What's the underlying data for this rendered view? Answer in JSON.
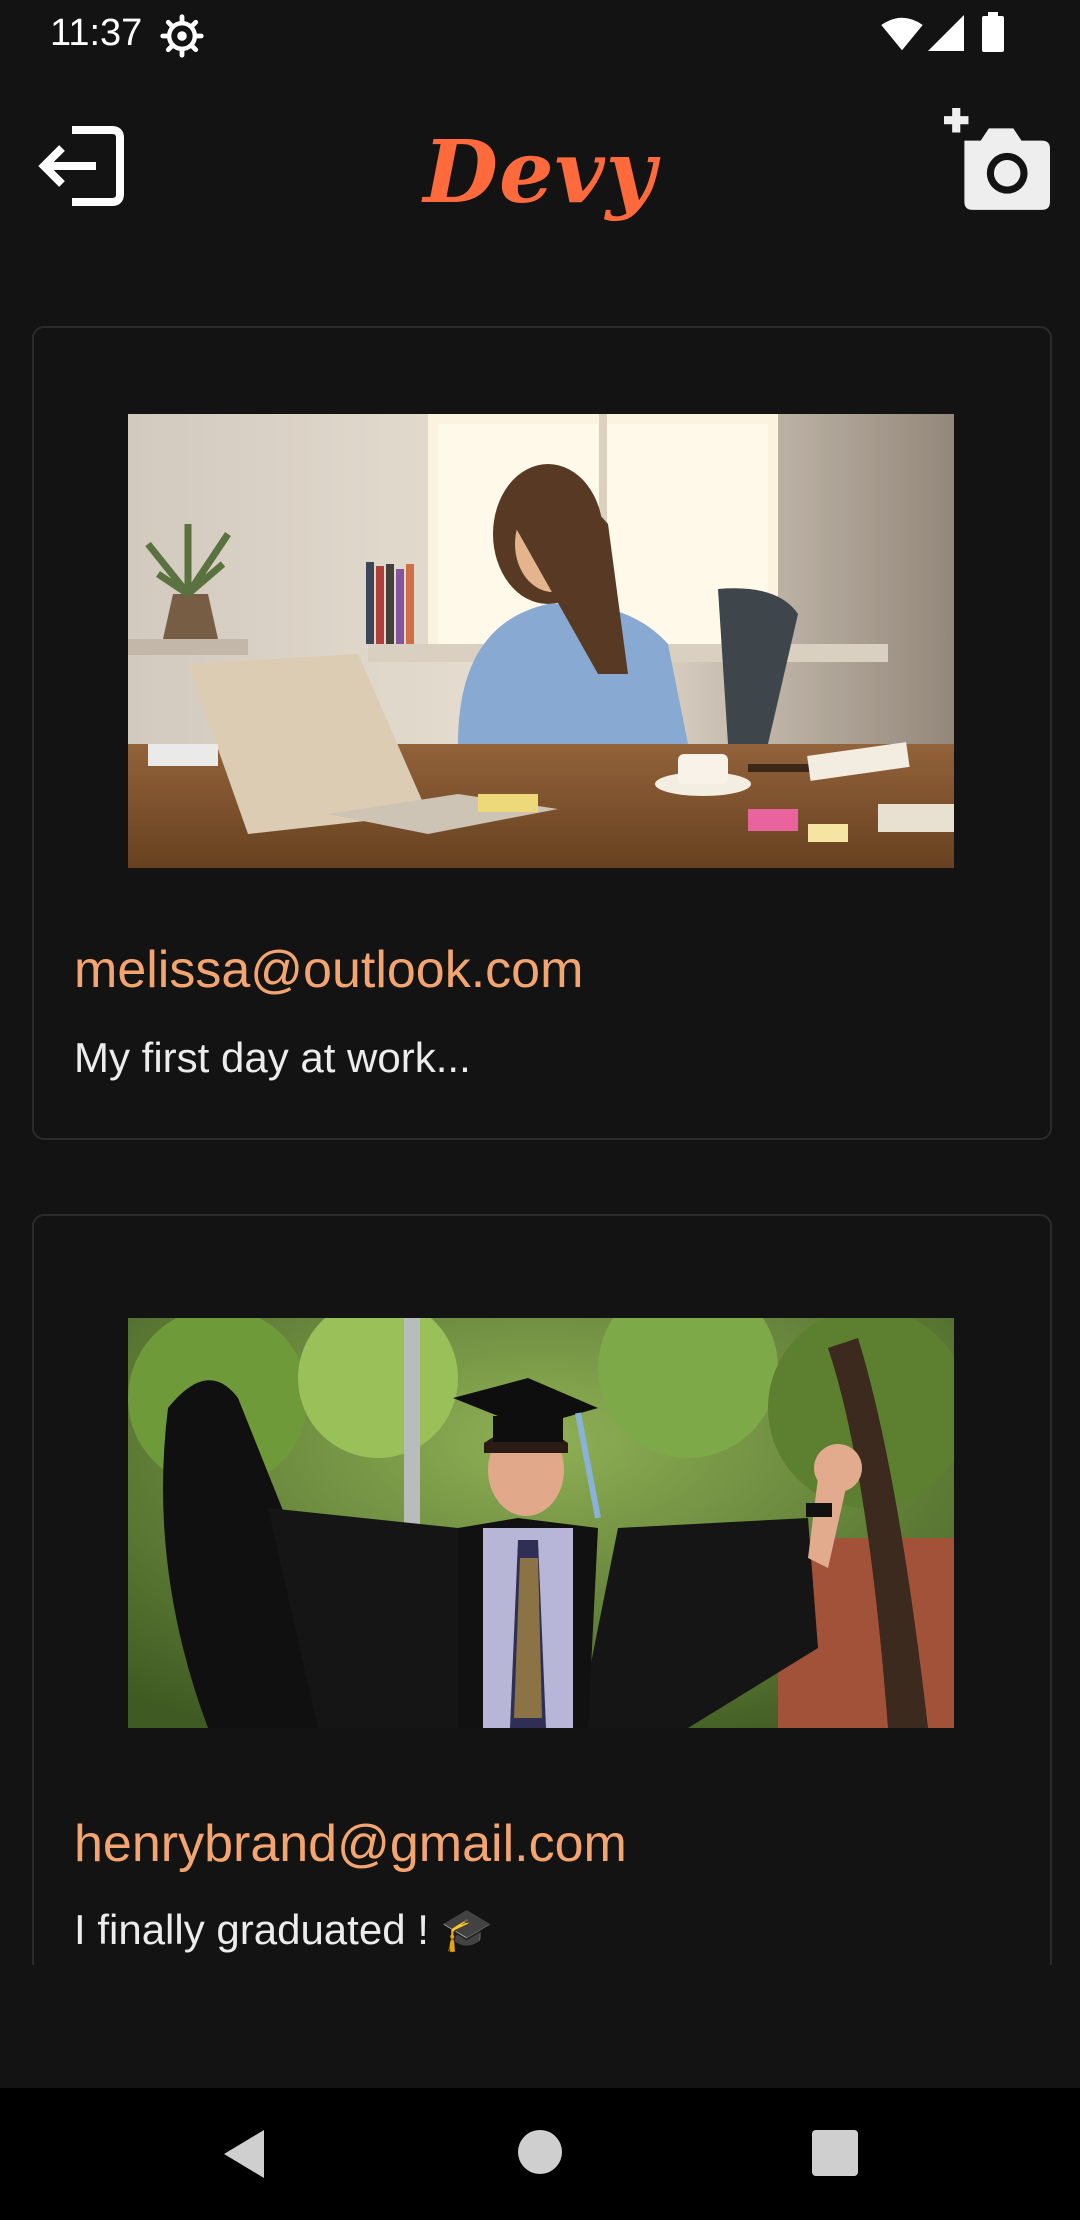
{
  "status_bar": {
    "time": "11:37",
    "icons": [
      "settings-icon",
      "wifi-icon",
      "signal-icon",
      "battery-icon"
    ]
  },
  "app_bar": {
    "title": "Devy",
    "left_icon": "logout-icon",
    "right_icon": "add-photo-icon",
    "accent_color": "#ff6a3d"
  },
  "posts": [
    {
      "author": "melissa@outlook.com",
      "caption": "My first day at work...",
      "image": "woman-working-at-laptop-photo"
    },
    {
      "author": "henrybrand@gmail.com",
      "caption": "I finally graduated ! 🎓",
      "image": "graduate-celebrating-photo"
    }
  ],
  "nav_bar": {
    "buttons": [
      "back-icon",
      "home-icon",
      "recents-icon"
    ]
  },
  "colors": {
    "background": "#131313",
    "author_text": "#f4a56f",
    "card_border": "#2b2b2b"
  }
}
